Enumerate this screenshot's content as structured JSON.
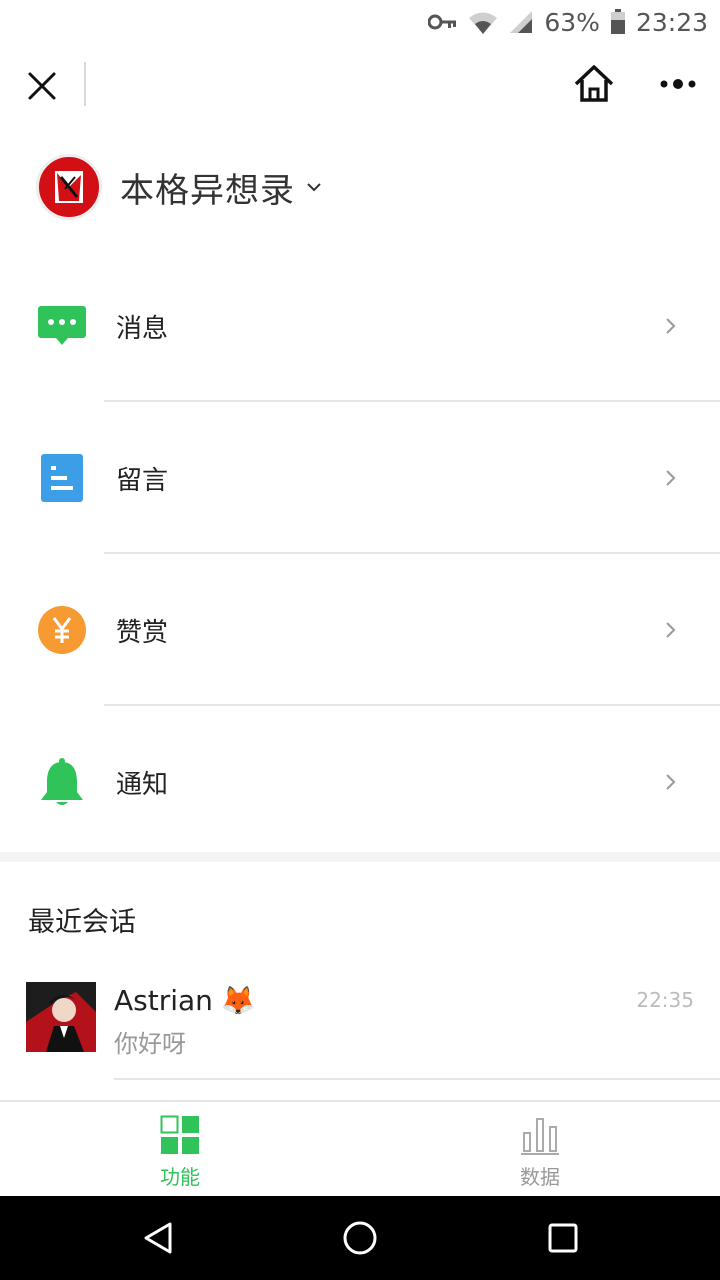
{
  "status_bar": {
    "battery": "63%",
    "time": "23:23",
    "icons": [
      "key-icon",
      "wifi-icon",
      "signal-icon",
      "battery-icon"
    ]
  },
  "top_nav": {
    "icons": [
      "close-icon",
      "home-icon",
      "more-icon"
    ]
  },
  "account": {
    "name": "本格异想录",
    "avatar_color": "#d10f14"
  },
  "menu": {
    "items": [
      {
        "label": "消息",
        "icon": "message-icon",
        "color": "#2fc35a"
      },
      {
        "label": "留言",
        "icon": "comment-doc-icon",
        "color": "#3b9ee6"
      },
      {
        "label": "赞赏",
        "icon": "yen-icon",
        "color": "#f79a31"
      },
      {
        "label": "通知",
        "icon": "bell-icon",
        "color": "#2fc35a"
      }
    ]
  },
  "recent": {
    "title": "最近会话",
    "conversations": [
      {
        "name": "Astrian",
        "emoji": "🦊",
        "message": "你好呀",
        "time": "22:35"
      }
    ]
  },
  "tabbar": {
    "tabs": [
      {
        "label": "功能",
        "active": true,
        "icon": "grid-icon"
      },
      {
        "label": "数据",
        "active": false,
        "icon": "bar-chart-icon"
      }
    ],
    "accent": "#2fc35a"
  },
  "system_nav": {
    "icons": [
      "back-icon",
      "home-circle-icon",
      "recents-icon"
    ]
  }
}
